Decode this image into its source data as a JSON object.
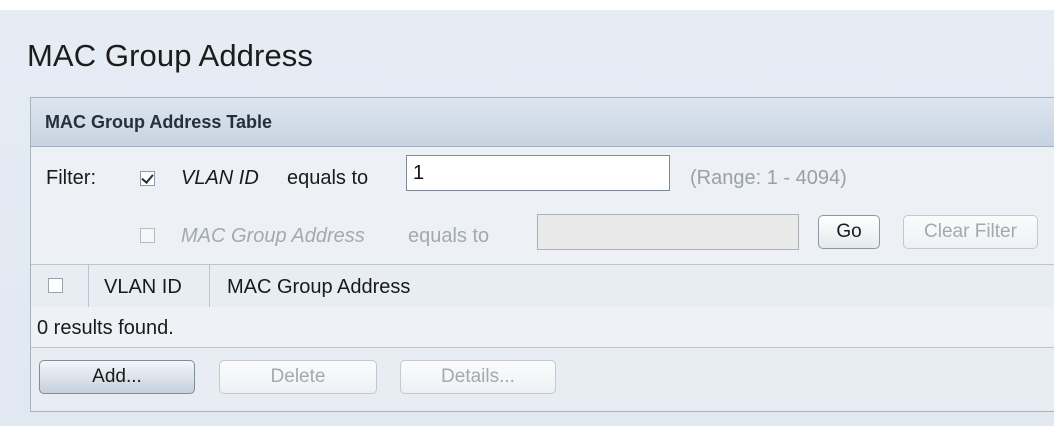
{
  "page": {
    "title": "MAC Group Address"
  },
  "table": {
    "title": "MAC Group Address Table",
    "columns": [
      "VLAN ID",
      "MAC Group Address"
    ],
    "rows": [],
    "results_text": "0 results found."
  },
  "filter": {
    "label": "Filter:",
    "vlan": {
      "checked": true,
      "field_name": "VLAN ID",
      "operator": "equals to",
      "value": "1",
      "range_hint": "(Range: 1 - 4094)"
    },
    "mac": {
      "checked": false,
      "enabled": false,
      "field_name": "MAC Group Address",
      "operator": "equals to",
      "value": ""
    },
    "go_label": "Go",
    "clear_label": "Clear Filter"
  },
  "actions": {
    "add_label": "Add...",
    "delete_label": "Delete",
    "details_label": "Details..."
  },
  "colors": {
    "header_bg": "#c7d3e1",
    "panel_border": "#a6b2c0",
    "disabled_text": "#a3a9b0"
  }
}
